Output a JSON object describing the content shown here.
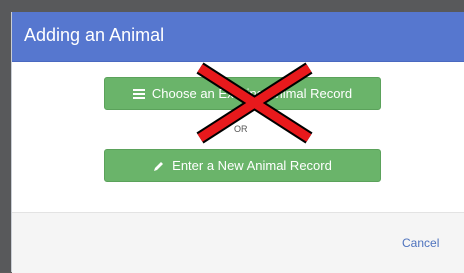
{
  "dialog": {
    "title": "Adding an Animal"
  },
  "actions": {
    "choose_label": "Choose an Existing Animal Record",
    "choose_icon": "list-icon",
    "or_text": "OR",
    "enter_label": "Enter a New Animal Record",
    "enter_icon": "pencil-icon"
  },
  "footer": {
    "cancel_label": "Cancel"
  },
  "colors": {
    "header": "#5677cf",
    "button": "#6ab46a",
    "cross": "#e8191c",
    "link": "#4e73be"
  }
}
